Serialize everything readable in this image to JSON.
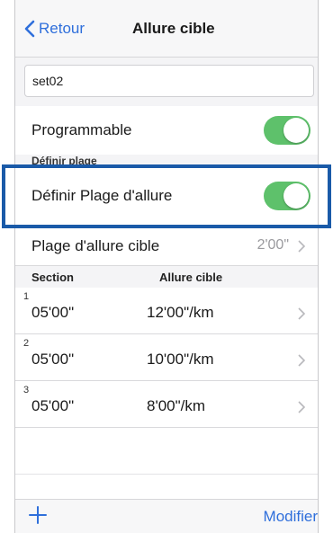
{
  "navbar": {
    "back_label": "Retour",
    "title": "Allure cible"
  },
  "name_input": {
    "value": "set02"
  },
  "programmable": {
    "label": "Programmable",
    "on": true
  },
  "range_section": {
    "header": "Définir plage"
  },
  "define_range": {
    "label": "Définir Plage d'allure",
    "on": true
  },
  "target_range": {
    "label": "Plage d'allure cible",
    "value": "2'00\""
  },
  "table": {
    "headers": {
      "section": "Section",
      "pace": "Allure cible"
    },
    "rows": [
      {
        "index": "1",
        "section": "05'00\"",
        "pace": "12'00\"/km"
      },
      {
        "index": "2",
        "section": "05'00\"",
        "pace": "10'00\"/km"
      },
      {
        "index": "3",
        "section": "05'00\"",
        "pace": "8'00\"/km"
      }
    ]
  },
  "toolbar": {
    "modify_label": "Modifier"
  },
  "colors": {
    "accent": "#2f6fdb",
    "toggle_on": "#5ec16b",
    "highlight": "#1a5aa8"
  },
  "icons": {
    "back": "chevron-left-icon",
    "disclosure": "chevron-right-icon",
    "add": "plus-icon"
  }
}
